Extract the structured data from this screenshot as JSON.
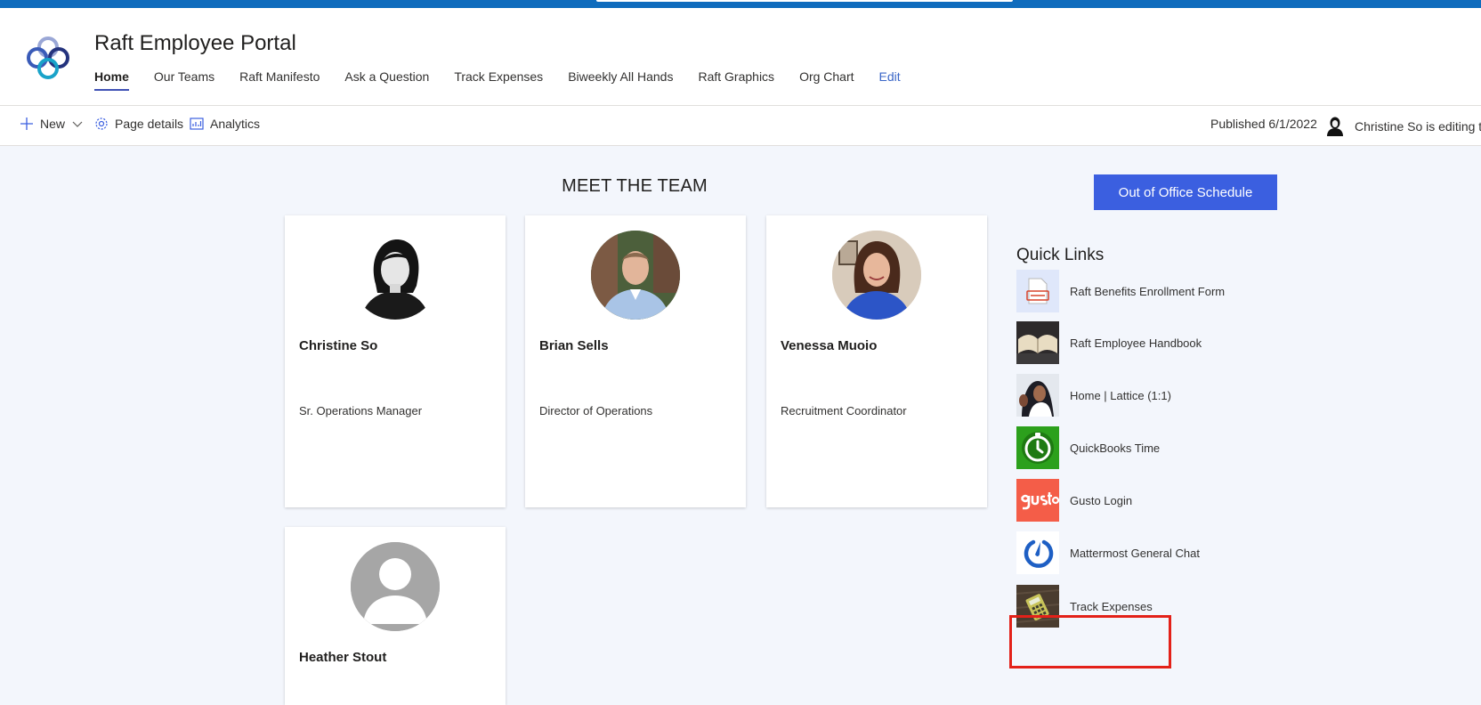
{
  "header": {
    "site_title": "Raft Employee Portal",
    "nav": [
      {
        "label": "Home",
        "active": true
      },
      {
        "label": "Our Teams"
      },
      {
        "label": "Raft Manifesto"
      },
      {
        "label": "Ask a Question"
      },
      {
        "label": "Track Expenses"
      },
      {
        "label": "Biweekly All Hands"
      },
      {
        "label": "Raft Graphics"
      },
      {
        "label": "Org Chart"
      },
      {
        "label": "Edit"
      }
    ]
  },
  "command_bar": {
    "new_label": "New",
    "page_details_label": "Page details",
    "analytics_label": "Analytics",
    "published_label": "Published 6/1/2022",
    "editing_label": "Christine So is editing t"
  },
  "team": {
    "title": "MEET THE TEAM",
    "members": [
      {
        "name": "Christine So",
        "role": "Sr. Operations Manager"
      },
      {
        "name": "Brian Sells",
        "role": "Director of Operations"
      },
      {
        "name": "Venessa Muoio",
        "role": "Recruitment Coordinator"
      },
      {
        "name": "Heather Stout",
        "role": ""
      }
    ]
  },
  "sidebar": {
    "ooo_button": "Out of Office Schedule",
    "quick_links_title": "Quick Links",
    "links": [
      {
        "label": "Raft Benefits Enrollment Form",
        "icon": "pdf-form-icon"
      },
      {
        "label": "Raft Employee Handbook",
        "icon": "book-thumbnail"
      },
      {
        "label": "Home | Lattice (1:1)",
        "icon": "lattice-thumbnail"
      },
      {
        "label": "QuickBooks Time",
        "icon": "clock-icon"
      },
      {
        "label": "Gusto Login",
        "icon": "gusto-logo"
      },
      {
        "label": "Mattermost General Chat",
        "icon": "mattermost-logo"
      },
      {
        "label": "Track Expenses",
        "icon": "calculator-thumbnail",
        "highlighted": true
      }
    ]
  },
  "colors": {
    "accent": "#3b5fe0",
    "topbar": "#0f6cbd",
    "highlight_border": "#e32119",
    "page_background": "#f3f6fc"
  }
}
